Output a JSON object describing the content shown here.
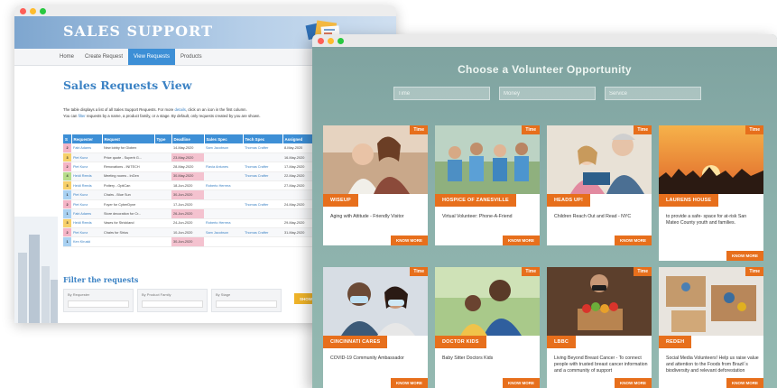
{
  "sales": {
    "brand": "SALES SUPPORT",
    "nav": [
      "Home",
      "Create Request",
      "View Requests",
      "Products"
    ],
    "active_nav": 2,
    "heading": "Sales Requests View",
    "desc_1a": "The table displays a list of all Sales Support Requests. For more ",
    "desc_1b": "details",
    "desc_1c": ", click on an icon in the first column.",
    "desc_2a": "You can ",
    "desc_2b": "filter",
    "desc_2c": " requests by a name, a product family, or a stage. By default, only requests created by you are shown.",
    "columns": [
      "S",
      "Requester",
      "Request",
      "Type",
      "Deadline",
      "Sales Spec",
      "Tech Spec",
      "Assigned"
    ],
    "rows": [
      {
        "stage": "2",
        "stage_color": "#f5b4c6",
        "requester": "Fabi Adams",
        "request": "New lobby for Globex",
        "type": "",
        "deadline": "14-May-2020",
        "deadline_warn": false,
        "sales_spec": "Sam Jacobson",
        "tech_spec": "Thomas Crafter",
        "assigned": "8-May-2020"
      },
      {
        "stage": "3",
        "stage_color": "#f7d06a",
        "requester": "Piet Kunz",
        "request": "Price quote - Superb G...",
        "type": "",
        "deadline": "23-May-2020",
        "deadline_warn": true,
        "sales_spec": "",
        "tech_spec": "",
        "assigned": "16-May-2020"
      },
      {
        "stage": "2",
        "stage_color": "#f5b4c6",
        "requester": "Piet Kunz",
        "request": "Renovations - INITECH",
        "type": "",
        "deadline": "28-May-2020",
        "deadline_warn": false,
        "sales_spec": "Flavia Antunes",
        "tech_spec": "Thomas Crafter",
        "assigned": "17-May-2020"
      },
      {
        "stage": "4",
        "stage_color": "#b7dd8b",
        "requester": "Heidi Reeds",
        "request": "Meeting rooms - InGen",
        "type": "",
        "deadline": "30-May-2020",
        "deadline_warn": true,
        "sales_spec": "",
        "tech_spec": "Thomas Crafter",
        "assigned": "22-May-2020"
      },
      {
        "stage": "3",
        "stage_color": "#f7d06a",
        "requester": "Heidi Reeds",
        "request": "Pottery - OptiCan",
        "type": "",
        "deadline": "18-Jun-2020",
        "deadline_warn": false,
        "sales_spec": "Roberto Herrera",
        "tech_spec": "",
        "assigned": "27-May-2020"
      },
      {
        "stage": "1",
        "stage_color": "#a9d1f2",
        "requester": "Piet Kunz",
        "request": "Chairs - Blue Sun",
        "type": "",
        "deadline": "30-Jun-2020",
        "deadline_warn": true,
        "sales_spec": "",
        "tech_spec": "",
        "assigned": ""
      },
      {
        "stage": "2",
        "stage_color": "#f5b4c6",
        "requester": "Piet Kunz",
        "request": "Foyer for CyberDyne",
        "type": "",
        "deadline": "17-Jun-2020",
        "deadline_warn": false,
        "sales_spec": "",
        "tech_spec": "Thomas Crafter",
        "assigned": "24-May-2020"
      },
      {
        "stage": "1",
        "stage_color": "#a9d1f2",
        "requester": "Fabi Adams",
        "request": "Store decoration for Cr...",
        "type": "",
        "deadline": "26-Jun-2020",
        "deadline_warn": true,
        "sales_spec": "",
        "tech_spec": "",
        "assigned": ""
      },
      {
        "stage": "3",
        "stage_color": "#f7d06a",
        "requester": "Heidi Reeds",
        "request": "Vases for Strickland",
        "type": "",
        "deadline": "24-Jun-2020",
        "deadline_warn": false,
        "sales_spec": "Roberto Herrera",
        "tech_spec": "",
        "assigned": "29-May-2020"
      },
      {
        "stage": "2",
        "stage_color": "#f5b4c6",
        "requester": "Piet Kunz",
        "request": "Chairs for Sirius",
        "type": "",
        "deadline": "10-Jun-2020",
        "deadline_warn": false,
        "sales_spec": "Sam Jacobson",
        "tech_spec": "Thomas Crafter",
        "assigned": "31-May-2020"
      },
      {
        "stage": "1",
        "stage_color": "#a9d1f2",
        "requester": "Ken Kiruski",
        "request": "",
        "type": "",
        "deadline": "30-Jun-2020",
        "deadline_warn": true,
        "sales_spec": "",
        "tech_spec": "",
        "assigned": ""
      }
    ],
    "filter_heading": "Filter the requests",
    "filters": [
      "By Requester",
      "By Product Family",
      "By Stage"
    ],
    "show_label": "SHOW"
  },
  "volunteer": {
    "heading": "Choose a Volunteer Opportunity",
    "search": {
      "time": "Time",
      "money": "Money",
      "service": "Service"
    },
    "more_label": "KNOW MORE",
    "cards": [
      {
        "tag": "Time",
        "org": "WISEUP",
        "desc": "Aging with Attitude - Friendly Visitor"
      },
      {
        "tag": "Time",
        "org": "HOSPICE OF ZANESVILLE",
        "desc": "Virtual Volunteer: Phone-A-Friend"
      },
      {
        "tag": "Time",
        "org": "HEADS UP!",
        "desc": "Children Reach Out and Read - NYC"
      },
      {
        "tag": "Time",
        "org": "LAURENS HOUSE",
        "desc": "to provide a safe- space for at-risk San Mateo County youth and families."
      },
      {
        "tag": "Time",
        "org": "CINCINNATI CARES",
        "desc": "COVID-19 Community Ambassador"
      },
      {
        "tag": "Time",
        "org": "DOCTOR KIDS",
        "desc": "Baby Sitter Doctors Kids"
      },
      {
        "tag": "Time",
        "org": "LBBC",
        "desc": "Living Beyond Breast Cancer - To connect people with trusted breast cancer information and a community of support"
      },
      {
        "tag": "Time",
        "org": "REDEH",
        "desc": "Social Media Volunteers! Help us raise value and attention to the Foods from Brazil´s biodiversity and relevant deforestation"
      }
    ]
  },
  "colors": {
    "accent_blue": "#3d8fd6",
    "accent_orange": "#e76f1c",
    "teal_bg": "#8bb0ab"
  }
}
